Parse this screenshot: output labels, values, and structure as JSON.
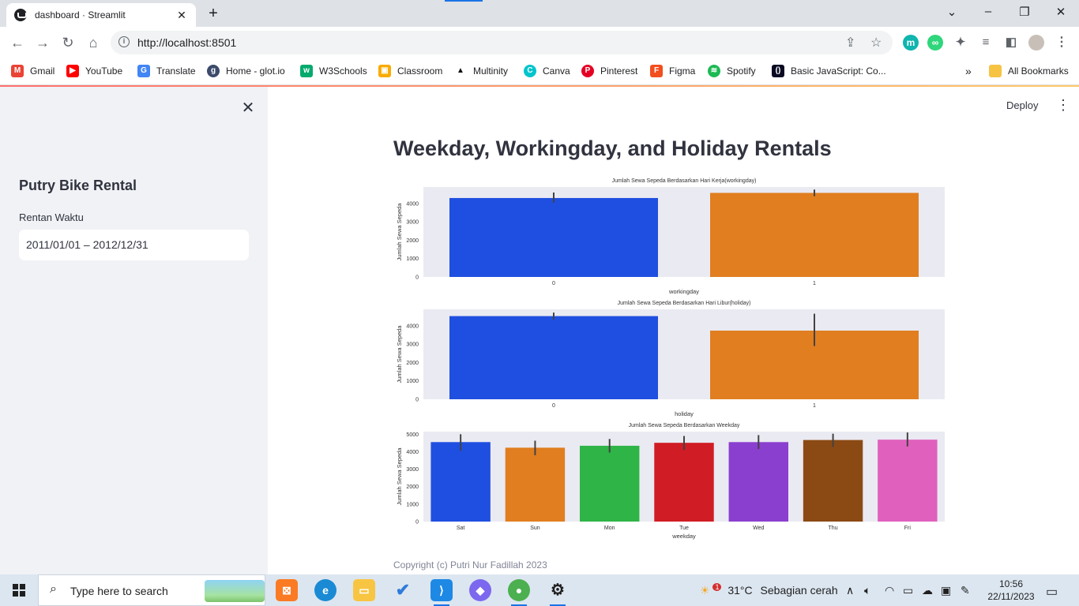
{
  "browser": {
    "tab_title": "dashboard · Streamlit",
    "url": "http://localhost:8501",
    "bookmarks": [
      {
        "label": "Gmail",
        "icon": "gmail-icon",
        "color": "#ea4335"
      },
      {
        "label": "YouTube",
        "icon": "youtube-icon",
        "color": "#ff0000"
      },
      {
        "label": "Translate",
        "icon": "translate-icon",
        "color": "#4285f4"
      },
      {
        "label": "Home - glot.io",
        "icon": "glot-icon",
        "color": "#3c4a6b"
      },
      {
        "label": "W3Schools",
        "icon": "w3schools-icon",
        "color": "#04aa6d"
      },
      {
        "label": "Classroom",
        "icon": "classroom-icon",
        "color": "#f9ab00"
      },
      {
        "label": "Multinity",
        "icon": "multinity-icon",
        "color": "#111111"
      },
      {
        "label": "Canva",
        "icon": "canva-icon",
        "color": "#00c4cc"
      },
      {
        "label": "Pinterest",
        "icon": "pinterest-icon",
        "color": "#e60023"
      },
      {
        "label": "Figma",
        "icon": "figma-icon",
        "color": "#f24e1e"
      },
      {
        "label": "Spotify",
        "icon": "spotify-icon",
        "color": "#1db954"
      },
      {
        "label": "Basic JavaScript: Co...",
        "icon": "freecodecamp-icon",
        "color": "#0a0a23"
      }
    ],
    "more_label": "»",
    "all_bookmarks": "All Bookmarks"
  },
  "sidebar": {
    "close_glyph": "✕",
    "title": "Putry Bike Rental",
    "date_label": "Rentan Waktu",
    "date_value": "2011/01/01 – 2012/12/31"
  },
  "header": {
    "deploy_label": "Deploy",
    "menu_glyph": "⋮"
  },
  "main": {
    "title": "Weekday, Workingday, and Holiday Rentals",
    "copyright": "Copyright (c) Putri Nur Fadillah 2023"
  },
  "colors": {
    "plot_bg": "#eaeaf2",
    "blue": "#1f4fe0",
    "orange": "#e07e20",
    "green": "#2fb447",
    "red": "#d01c24",
    "purple": "#8b3fcf",
    "brown": "#8b4a14",
    "pink": "#e060bd",
    "errbar": "#424242"
  },
  "chart_data": [
    {
      "type": "bar",
      "title": "Jumlah Sewa Sepeda Berdasarkan Hari Kerja(workingday)",
      "xlabel": "workingday",
      "ylabel": "Jumlah Sewa Sepeda",
      "categories": [
        "0",
        "1"
      ],
      "values": [
        4300,
        4580
      ],
      "errors": [
        [
          4050,
          4600
        ],
        [
          4400,
          4760
        ]
      ],
      "yticks": [
        0,
        1000,
        2000,
        3000,
        4000
      ],
      "ylim": [
        0,
        4900
      ],
      "colors": [
        "#1f4fe0",
        "#e07e20"
      ],
      "grid": false
    },
    {
      "type": "bar",
      "title": "Jumlah Sewa Sepeda Berdasarkan Hari Libur(holiday)",
      "xlabel": "holiday",
      "ylabel": "Jumlah Sewa Sepeda",
      "categories": [
        "0",
        "1"
      ],
      "values": [
        4530,
        3740
      ],
      "errors": [
        [
          4340,
          4720
        ],
        [
          2900,
          4660
        ]
      ],
      "yticks": [
        0,
        1000,
        2000,
        3000,
        4000
      ],
      "ylim": [
        0,
        4900
      ],
      "colors": [
        "#1f4fe0",
        "#e07e20"
      ],
      "grid": false
    },
    {
      "type": "bar",
      "title": "Jumlah Sewa Sepeda Berdasarkan Weekday",
      "xlabel": "weekday",
      "ylabel": "Jumlah Sewa Sepeda",
      "categories": [
        "Sat",
        "Sun",
        "Mon",
        "Tue",
        "Wed",
        "Thu",
        "Fri"
      ],
      "values": [
        4550,
        4230,
        4340,
        4510,
        4550,
        4670,
        4690
      ],
      "errors": [
        [
          4050,
          5000
        ],
        [
          3800,
          4630
        ],
        [
          3950,
          4730
        ],
        [
          4100,
          4900
        ],
        [
          4150,
          4950
        ],
        [
          4270,
          5030
        ],
        [
          4300,
          5100
        ]
      ],
      "yticks": [
        0,
        1000,
        2000,
        3000,
        4000,
        5000
      ],
      "ylim": [
        0,
        5150
      ],
      "colors": [
        "#1f4fe0",
        "#e07e20",
        "#2fb447",
        "#d01c24",
        "#8b3fcf",
        "#8b4a14",
        "#e060bd"
      ],
      "grid": false
    }
  ],
  "taskbar": {
    "search_placeholder": "Type here to search",
    "weather_badge": "1",
    "temperature": "31°C",
    "weather_desc": "Sebagian cerah",
    "time": "10:56",
    "date": "22/11/2023"
  }
}
